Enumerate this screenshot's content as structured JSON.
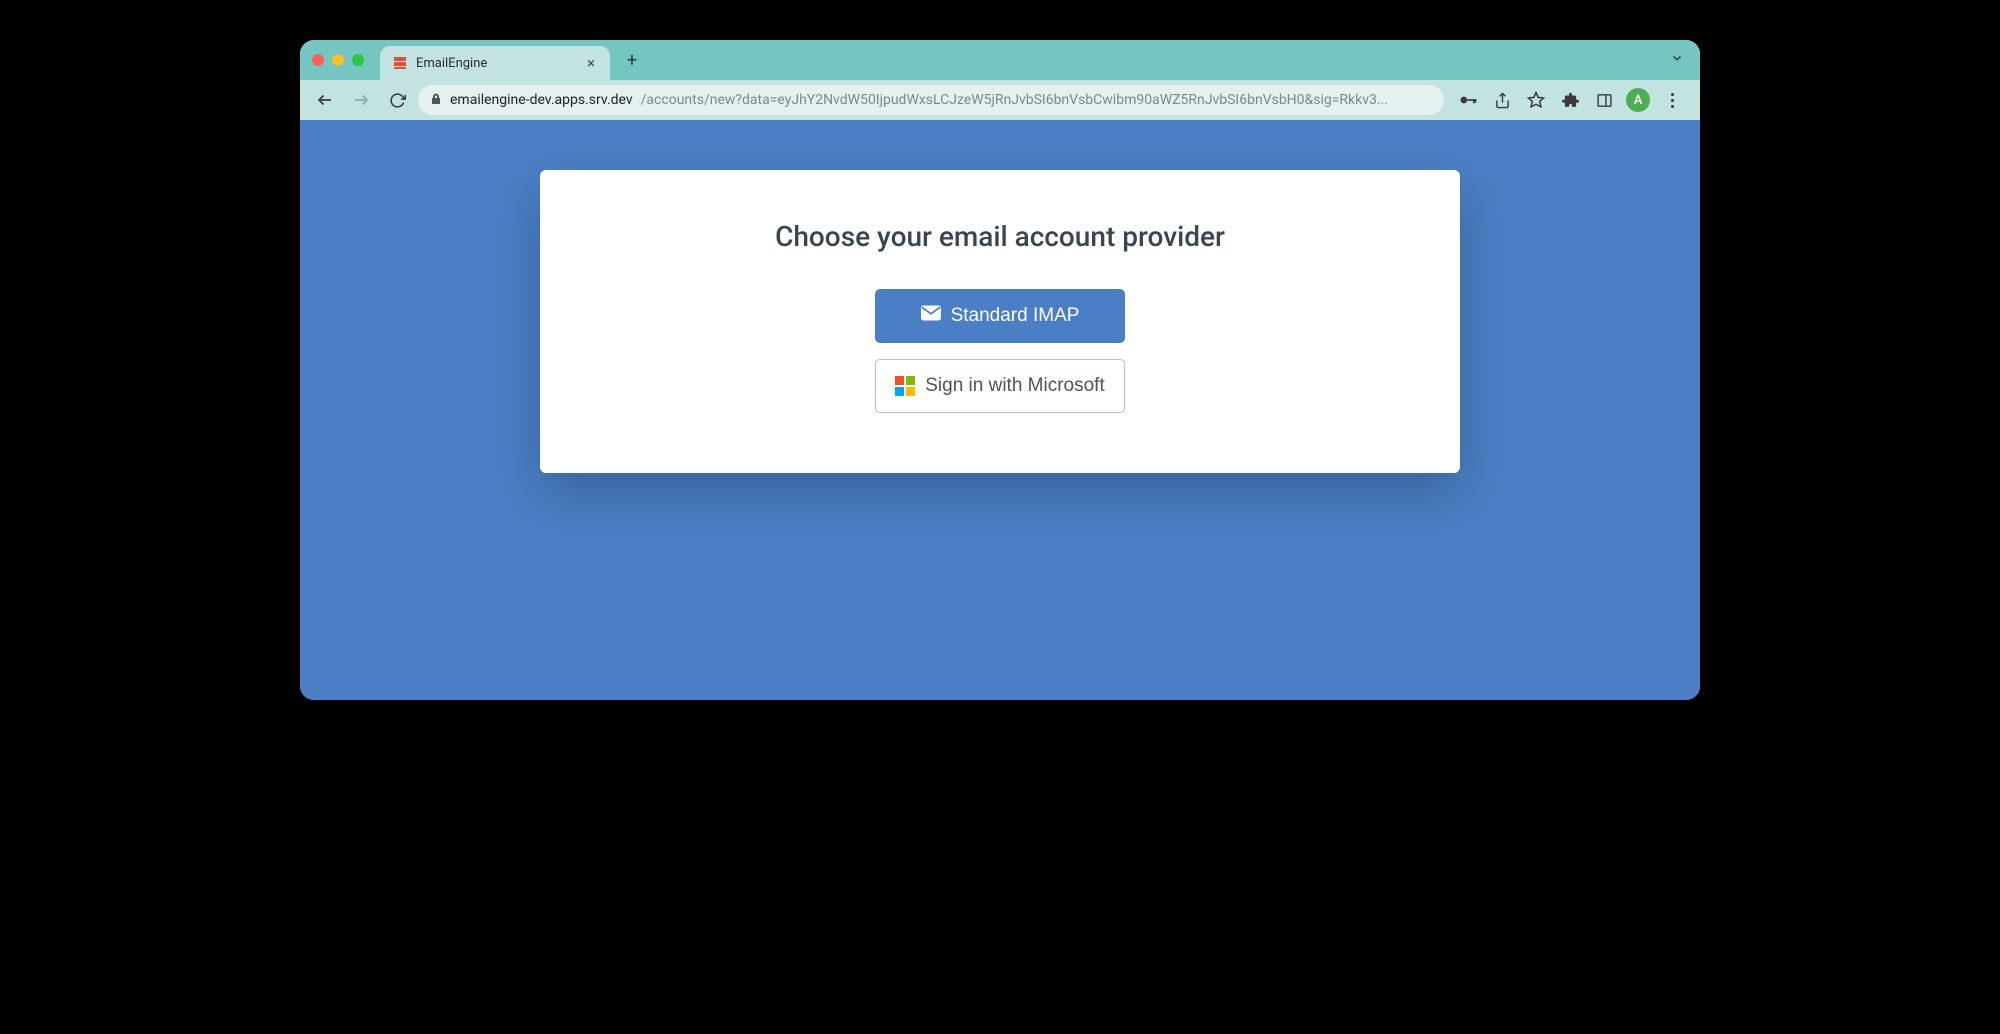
{
  "browser": {
    "tab_title": "EmailEngine",
    "url_host": "emailengine-dev.apps.srv.dev",
    "url_path": "/accounts/new?data=eyJhY2NvdW50IjpudWxsLCJzeW5jRnJvbSI6bnVsbCwibm90aWZ5RnJvbSI6bnVsbH0&sig=Rkkv3...",
    "avatar_initial": "A"
  },
  "page": {
    "heading": "Choose your email account provider",
    "buttons": {
      "imap": "Standard IMAP",
      "microsoft": "Sign in with Microsoft"
    }
  }
}
